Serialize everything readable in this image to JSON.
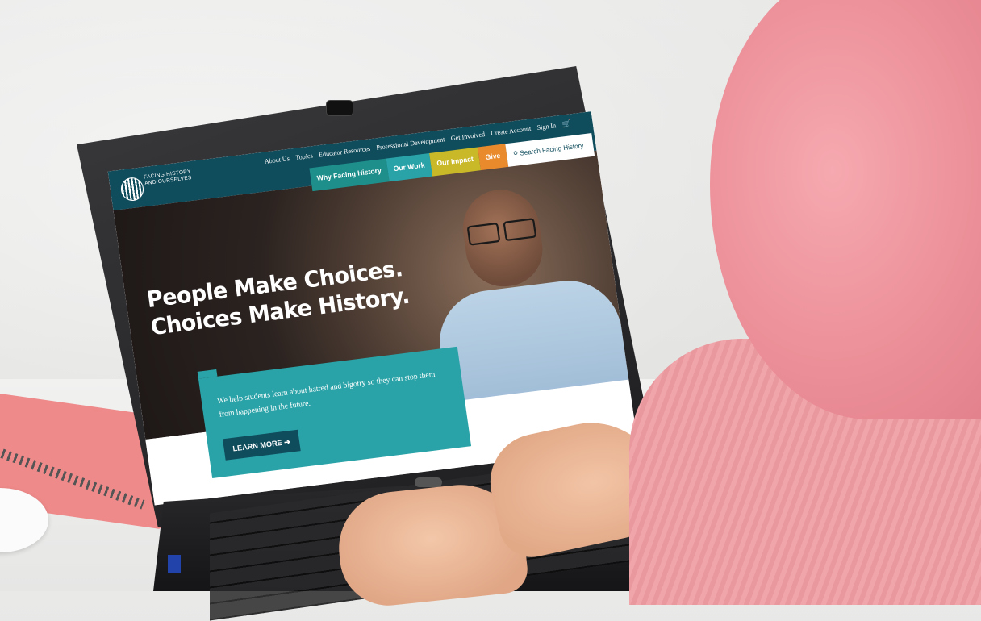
{
  "site": {
    "logo_text": "FACING HISTORY AND OURSELVES",
    "top_nav": [
      "About Us",
      "Topics",
      "Educator Resources",
      "Professional Development",
      "Get Involved",
      "Create Account",
      "Sign In"
    ],
    "cart_icon": "cart-icon",
    "secondary_nav": [
      {
        "label": "Why Facing History",
        "color": "#1f8f8c"
      },
      {
        "label": "Our Work",
        "color": "#2aa3a8"
      },
      {
        "label": "Our Impact",
        "color": "#c9b827"
      },
      {
        "label": "Give",
        "color": "#e98a2c"
      }
    ],
    "search_placeholder": "Search Facing History",
    "hero_headline_1": "People Make Choices.",
    "hero_headline_2": "Choices Make History.",
    "cta_text": "We help students learn about hatred and bigotry so they can stop them from happening in the future.",
    "cta_button": "LEARN MORE",
    "brand_teal": "#0f4c5c",
    "accent_teal": "#2aa3a8"
  }
}
